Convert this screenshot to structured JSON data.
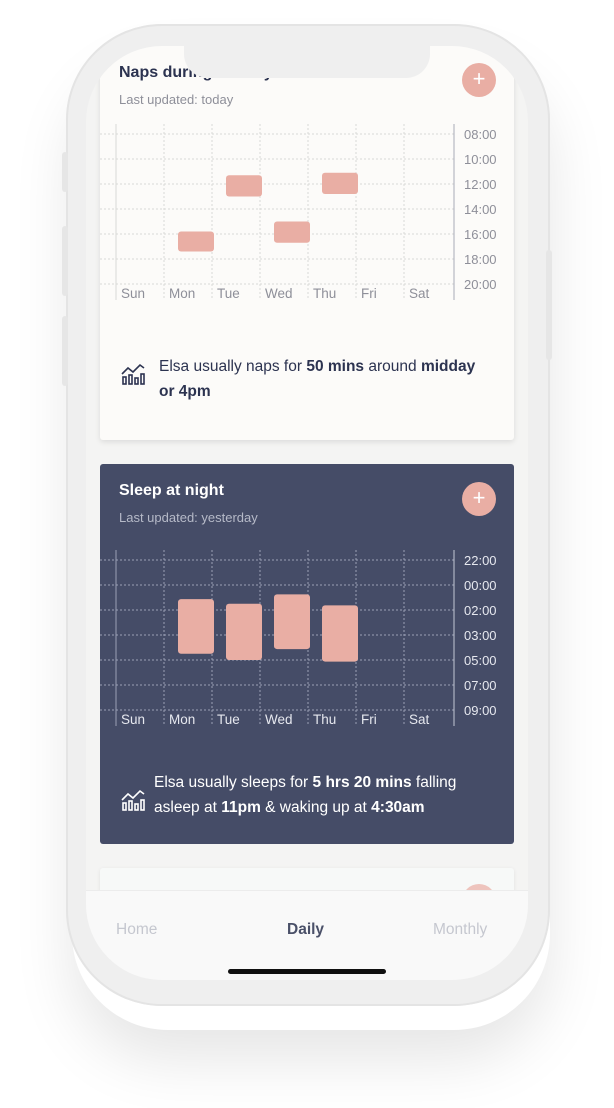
{
  "naps": {
    "title": "Naps during the day",
    "updated": "Last updated: today",
    "add_label": "+",
    "days": [
      "Sun",
      "Mon",
      "Tue",
      "Wed",
      "Thu",
      "Fri",
      "Sat"
    ],
    "times": [
      "08:00",
      "10:00",
      "12:00",
      "14:00",
      "16:00",
      "18:00",
      "20:00"
    ],
    "blocks": [
      {
        "day": "Mon",
        "start": 15.8,
        "end": 17.4
      },
      {
        "day": "Tue",
        "start": 11.3,
        "end": 13.0
      },
      {
        "day": "Wed",
        "start": 15.0,
        "end": 16.7
      },
      {
        "day": "Thu",
        "start": 11.1,
        "end": 12.8
      }
    ],
    "summary": {
      "pre": "Elsa usually naps for ",
      "b1": "50 mins",
      "mid": " around ",
      "b2": "midday or 4pm",
      "post": ""
    }
  },
  "night": {
    "title": "Sleep at night",
    "updated": "Last updated: yesterday",
    "add_label": "+",
    "days": [
      "Sun",
      "Mon",
      "Tue",
      "Wed",
      "Thu",
      "Fri",
      "Sat"
    ],
    "times": [
      "22:00",
      "00:00",
      "02:00",
      "03:00",
      "05:00",
      "07:00",
      "09:00"
    ],
    "blocks": [
      {
        "day": "Mon",
        "start": 0.5,
        "end": 4.0
      },
      {
        "day": "Tue",
        "start": 0.8,
        "end": 4.4
      },
      {
        "day": "Wed",
        "start": 0.2,
        "end": 3.7
      },
      {
        "day": "Thu",
        "start": 0.9,
        "end": 4.5
      }
    ],
    "summary": {
      "pre": "Elsa usually sleeps for ",
      "b1": "5 hrs 20 mins",
      "mid": " falling asleep at ",
      "b2": "11pm",
      "mid2": " & waking up at ",
      "b3": "4:30am"
    }
  },
  "tabs": [
    "Home",
    "Daily",
    "Monthly"
  ],
  "active_tab": "Daily",
  "colors": {
    "accent": "#e9aea4",
    "navy": "#454c67",
    "text_dark": "#2c3350"
  }
}
